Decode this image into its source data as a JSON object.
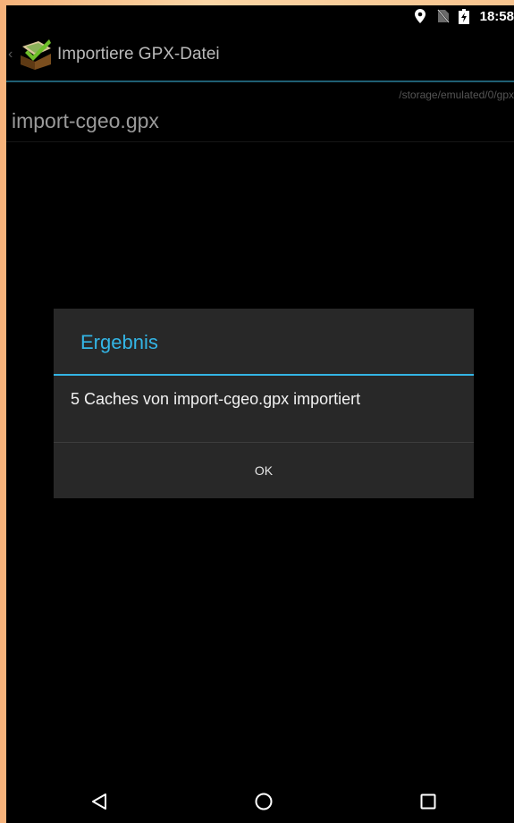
{
  "status_bar": {
    "time": "18:58",
    "icons": [
      "location-icon",
      "no-sim-icon",
      "battery-charging-icon"
    ]
  },
  "action_bar": {
    "title": "Importiere GPX-Datei",
    "app_icon": "cgeo-app-icon"
  },
  "file_list": {
    "path": "/storage/emulated/0/gpx",
    "file_name": "import-cgeo.gpx"
  },
  "dialog": {
    "title": "Ergebnis",
    "message": "5 Caches von import-cgeo.gpx importiert",
    "ok_label": "OK",
    "accent_color": "#33b5e5"
  },
  "nav_bar": {
    "icons": [
      "back-icon",
      "home-icon",
      "recents-icon"
    ]
  }
}
